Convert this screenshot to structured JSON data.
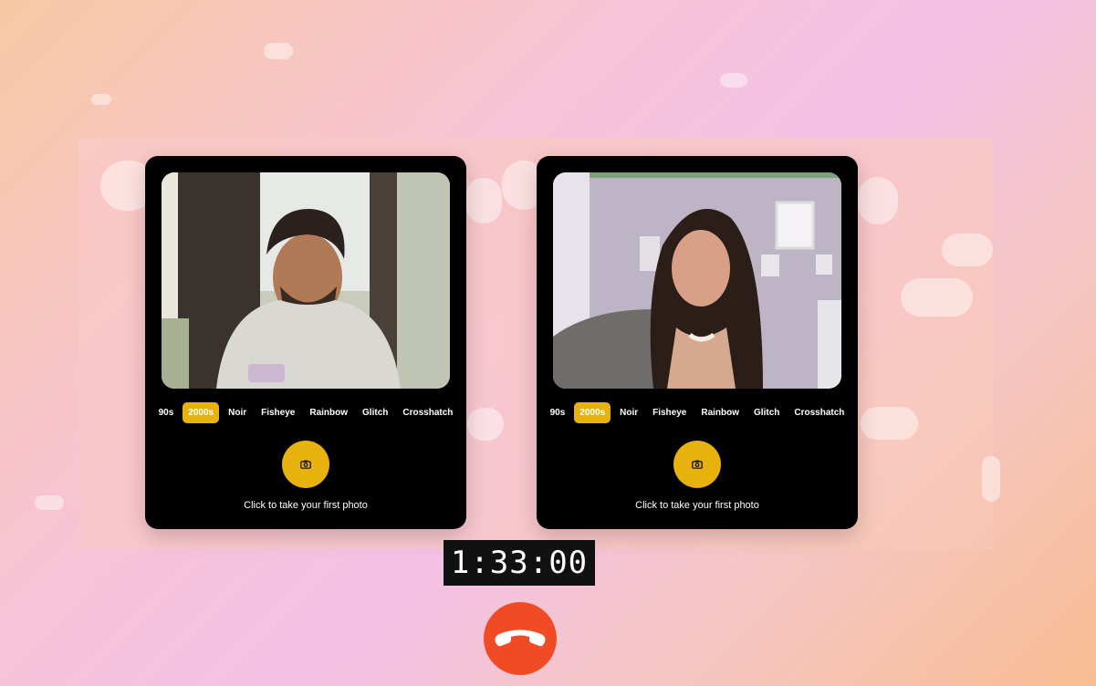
{
  "participants": [
    {
      "filters": [
        "90s",
        "2000s",
        "Noir",
        "Fisheye",
        "Rainbow",
        "Glitch",
        "Crosshatch"
      ],
      "active_filter": "2000s",
      "hint": "Click to take your first photo"
    },
    {
      "filters": [
        "90s",
        "2000s",
        "Noir",
        "Fisheye",
        "Rainbow",
        "Glitch",
        "Crosshatch"
      ],
      "active_filter": "2000s",
      "hint": "Click to take your first photo"
    }
  ],
  "timer": "1:33:00",
  "icons": {
    "shutter": "camera-icon",
    "hangup": "phone-hangup-icon"
  },
  "colors": {
    "accent": "#e8b20e",
    "hangup": "#f04b25",
    "card": "#000000"
  }
}
